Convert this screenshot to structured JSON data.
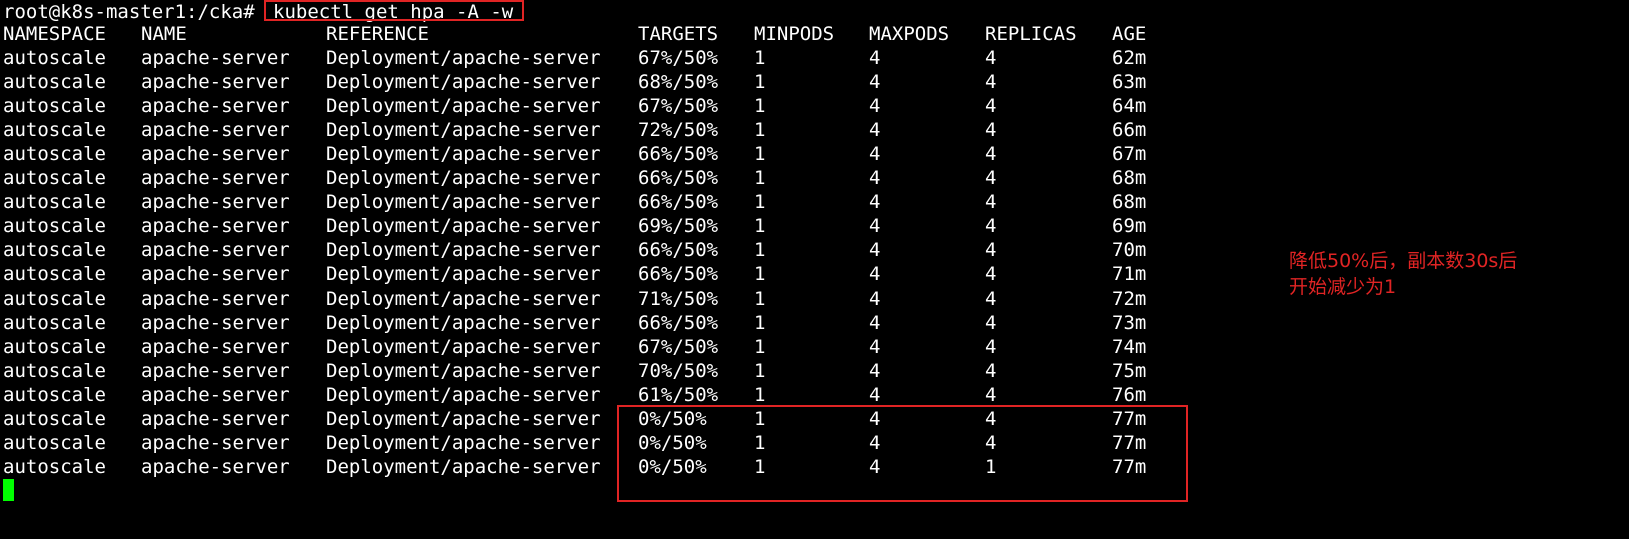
{
  "terminal": {
    "prompt": "root@k8s-master1:/cka#",
    "command": "kubectl get hpa -A -w",
    "headers": {
      "namespace": "NAMESPACE",
      "name": "NAME",
      "reference": "REFERENCE",
      "targets": "TARGETS",
      "minpods": "MINPODS",
      "maxpods": "MAXPODS",
      "replicas": "REPLICAS",
      "age": "AGE"
    },
    "rows": [
      {
        "namespace": "autoscale",
        "name": "apache-server",
        "reference": "Deployment/apache-server",
        "targets": "67%/50%",
        "minpods": "1",
        "maxpods": "4",
        "replicas": "4",
        "age": "62m"
      },
      {
        "namespace": "autoscale",
        "name": "apache-server",
        "reference": "Deployment/apache-server",
        "targets": "68%/50%",
        "minpods": "1",
        "maxpods": "4",
        "replicas": "4",
        "age": "63m"
      },
      {
        "namespace": "autoscale",
        "name": "apache-server",
        "reference": "Deployment/apache-server",
        "targets": "67%/50%",
        "minpods": "1",
        "maxpods": "4",
        "replicas": "4",
        "age": "64m"
      },
      {
        "namespace": "autoscale",
        "name": "apache-server",
        "reference": "Deployment/apache-server",
        "targets": "72%/50%",
        "minpods": "1",
        "maxpods": "4",
        "replicas": "4",
        "age": "66m"
      },
      {
        "namespace": "autoscale",
        "name": "apache-server",
        "reference": "Deployment/apache-server",
        "targets": "66%/50%",
        "minpods": "1",
        "maxpods": "4",
        "replicas": "4",
        "age": "67m"
      },
      {
        "namespace": "autoscale",
        "name": "apache-server",
        "reference": "Deployment/apache-server",
        "targets": "66%/50%",
        "minpods": "1",
        "maxpods": "4",
        "replicas": "4",
        "age": "68m"
      },
      {
        "namespace": "autoscale",
        "name": "apache-server",
        "reference": "Deployment/apache-server",
        "targets": "66%/50%",
        "minpods": "1",
        "maxpods": "4",
        "replicas": "4",
        "age": "68m"
      },
      {
        "namespace": "autoscale",
        "name": "apache-server",
        "reference": "Deployment/apache-server",
        "targets": "69%/50%",
        "minpods": "1",
        "maxpods": "4",
        "replicas": "4",
        "age": "69m"
      },
      {
        "namespace": "autoscale",
        "name": "apache-server",
        "reference": "Deployment/apache-server",
        "targets": "66%/50%",
        "minpods": "1",
        "maxpods": "4",
        "replicas": "4",
        "age": "70m"
      },
      {
        "namespace": "autoscale",
        "name": "apache-server",
        "reference": "Deployment/apache-server",
        "targets": "66%/50%",
        "minpods": "1",
        "maxpods": "4",
        "replicas": "4",
        "age": "71m"
      },
      {
        "namespace": "autoscale",
        "name": "apache-server",
        "reference": "Deployment/apache-server",
        "targets": "71%/50%",
        "minpods": "1",
        "maxpods": "4",
        "replicas": "4",
        "age": "72m"
      },
      {
        "namespace": "autoscale",
        "name": "apache-server",
        "reference": "Deployment/apache-server",
        "targets": "66%/50%",
        "minpods": "1",
        "maxpods": "4",
        "replicas": "4",
        "age": "73m"
      },
      {
        "namespace": "autoscale",
        "name": "apache-server",
        "reference": "Deployment/apache-server",
        "targets": "67%/50%",
        "minpods": "1",
        "maxpods": "4",
        "replicas": "4",
        "age": "74m"
      },
      {
        "namespace": "autoscale",
        "name": "apache-server",
        "reference": "Deployment/apache-server",
        "targets": "70%/50%",
        "minpods": "1",
        "maxpods": "4",
        "replicas": "4",
        "age": "75m"
      },
      {
        "namespace": "autoscale",
        "name": "apache-server",
        "reference": "Deployment/apache-server",
        "targets": "61%/50%",
        "minpods": "1",
        "maxpods": "4",
        "replicas": "4",
        "age": "76m"
      },
      {
        "namespace": "autoscale",
        "name": "apache-server",
        "reference": "Deployment/apache-server",
        "targets": "0%/50%",
        "minpods": "1",
        "maxpods": "4",
        "replicas": "4",
        "age": "77m"
      },
      {
        "namespace": "autoscale",
        "name": "apache-server",
        "reference": "Deployment/apache-server",
        "targets": "0%/50%",
        "minpods": "1",
        "maxpods": "4",
        "replicas": "4",
        "age": "77m"
      },
      {
        "namespace": "autoscale",
        "name": "apache-server",
        "reference": "Deployment/apache-server",
        "targets": "0%/50%",
        "minpods": "1",
        "maxpods": "4",
        "replicas": "1",
        "age": "77m"
      }
    ]
  },
  "annotation": {
    "line1": "降低50%后，副本数30s后",
    "line2": "开始减少为1"
  },
  "colors": {
    "background": "#000000",
    "text": "#ffffff",
    "highlight_box": "#e02424",
    "annotation": "#e02424",
    "cursor": "#00ff00"
  }
}
